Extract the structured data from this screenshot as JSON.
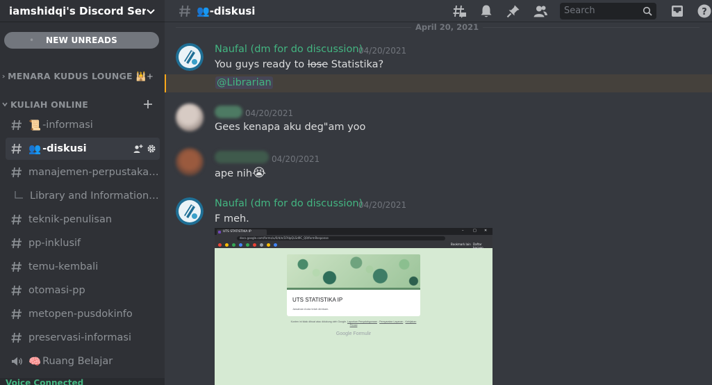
{
  "server": {
    "name": "iamshidqi's Discord Server"
  },
  "sidebar": {
    "new_unreads": "NEW UNREADS",
    "categories": [
      {
        "label": "MENARA KUDUS LOUNGE 🕌"
      },
      {
        "label": "KULIAH ONLINE"
      }
    ],
    "channels": [
      {
        "emoji": "📜",
        "label": "-informasi"
      },
      {
        "emoji": "👥",
        "label": "-diskusi"
      },
      {
        "label": "manajemen-perpustakaan"
      },
      {
        "label": "Library and Information C..."
      },
      {
        "label": "teknik-penulisan"
      },
      {
        "label": "pp-inklusif"
      },
      {
        "label": "temu-kembali"
      },
      {
        "label": "otomasi-pp"
      },
      {
        "label": "metopen-pusdokinfo"
      },
      {
        "label": "preservasi-informasi"
      },
      {
        "emoji": "🧠",
        "label": "Ruang Belajar"
      }
    ],
    "voice_status": "Voice Connected"
  },
  "header": {
    "channel_emoji": "👥",
    "channel_name": "-diskusi",
    "search_placeholder": "Search"
  },
  "messages": {
    "date_divider": "April 20, 2021",
    "m1": {
      "author": "Naufal (dm for do discussion)",
      "timestamp": "04/20/2021",
      "text_before": "You guys ready to ",
      "text_strike": "lose",
      "text_after": " Statistika?",
      "mention": "@Librarian"
    },
    "m2": {
      "timestamp": "04/20/2021",
      "text": "Gees kenapa aku deg\"am yoo"
    },
    "m3": {
      "timestamp": "04/20/2021",
      "text": "ape nih",
      "emoji": "😭"
    },
    "m4": {
      "author": "Naufal (dm for do discussion)",
      "timestamp": "04/20/2021",
      "text": "F meh."
    }
  },
  "attachment": {
    "tab_title": "UTS STATISTIKA IP",
    "url": "docs.google.com/forms/u/0/d/e/1FAIpQLSd9C_Q0/formResponse",
    "bookmark_1": "Bookmark lain",
    "bookmark_2": "Daftar bacaan",
    "form_title": "UTS STATISTIKA IP",
    "form_subtitle": "Jawaban Anda telah direkam.",
    "footer_text": "Konten ini tidak dibuat atau didukung oleh Google.",
    "footer_link_1": "Laporkan Penyalahgunaan",
    "footer_link_2": "Persyaratan Layanan",
    "footer_link_3": "Kebijakan Privasi",
    "brand": "Google Formulir"
  },
  "colors": {
    "author_green": "#43b581",
    "sidebar_bg": "#2f3136",
    "chat_bg": "#36393f",
    "mention_bar": "#faa81a"
  }
}
